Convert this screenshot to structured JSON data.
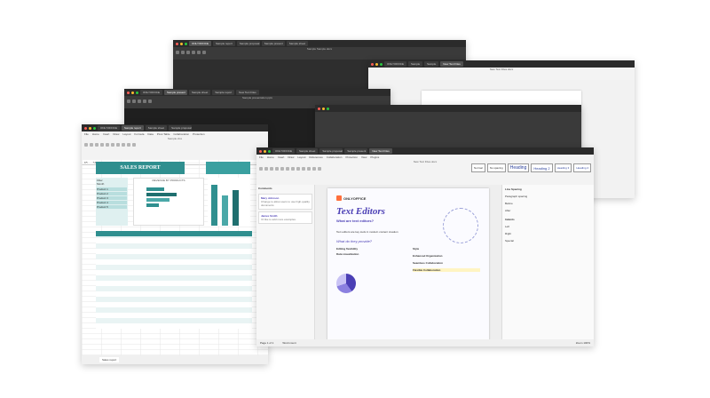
{
  "colors": {
    "titlebar": "#2b2b2b",
    "accent_green": "#2f8f8f",
    "accent_purple": "#4b3fb5",
    "onlyoffice_orange": "#ff6f3d"
  },
  "windows": {
    "back_top": {
      "tab_labels": [
        "ONLYOFFICE",
        "Sample report",
        "Sample proposal",
        "Sample present",
        "Sample sheet"
      ],
      "docname": "Sample Sample.docx"
    },
    "back_right": {
      "tab_labels": [
        "ONLYOFFICE",
        "Sample",
        "Sample",
        "New Text Files"
      ],
      "docname": "New Text Files.docx"
    },
    "back_middle": {
      "tab_labels": [
        "ONLYOFFICE",
        "Sample present",
        "Sample sheet",
        "Sample report",
        "New Text Files"
      ],
      "docname": "Sample presentation.pptx"
    },
    "spreadsheet": {
      "tab_labels": [
        "ONLYOFFICE",
        "Sample report",
        "Sample sheet",
        "Sample proposal",
        "New Text Files"
      ],
      "menu": [
        "File",
        "Home",
        "Insert",
        "Draw",
        "Layout",
        "Formula",
        "Data",
        "Pivot Table",
        "Collaboration",
        "Protection",
        "View",
        "Plugins"
      ],
      "docname": "Sample.xlsx",
      "cell_ref": "E5",
      "formula": "SALES REPORT",
      "banner": "SALES REPORT",
      "chart_title": "REVENUE BY PRODUCTS",
      "side_labels": [
        "Filter",
        "Month",
        "Product 1",
        "Product 2",
        "Product 3",
        "Product 4",
        "Product 5"
      ],
      "sheet_tab": "Sales report"
    },
    "document": {
      "tab_labels": [
        "ONLYOFFICE",
        "Sample sheet",
        "Sample proposal",
        "Sample present",
        "New Text Files"
      ],
      "menu": [
        "File",
        "Home",
        "Insert",
        "Draw",
        "Layout",
        "References",
        "Collaboration",
        "Protection",
        "View",
        "Plugins"
      ],
      "docname": "New Text Files.docx",
      "styles": [
        "Normal",
        "No spacing",
        "Heading",
        "Heading 2",
        "Heading 3",
        "Heading 4"
      ],
      "comments_title": "Comments",
      "comments": [
        {
          "author": "Mary Johnson",
          "text": "Change to allow users to use high-quality documents"
        },
        {
          "author": "James Smith",
          "text": "I'd like to add more examples."
        }
      ],
      "brand": "ONLYOFFICE",
      "heading": "Text Editors",
      "subheading": "What are text editors?",
      "body_intro": "Text editors are key tools in modern content creation",
      "section": "What do they provide?",
      "bullets_left": [
        "Editing flexibility",
        "Data visualization"
      ],
      "bullets_right": [
        "Style",
        "Enhanced Organization",
        "Seamless Collaboration",
        "Flexible Collaboration"
      ],
      "status_page": "Page 1 of 1",
      "status_words": "Word count",
      "zoom": "Zoom 100%",
      "right_panel": {
        "title": "Line Spacing",
        "items": [
          "Paragraph spacing",
          "Before",
          "After",
          "Indents",
          "Left",
          "Right",
          "Special"
        ]
      }
    }
  }
}
